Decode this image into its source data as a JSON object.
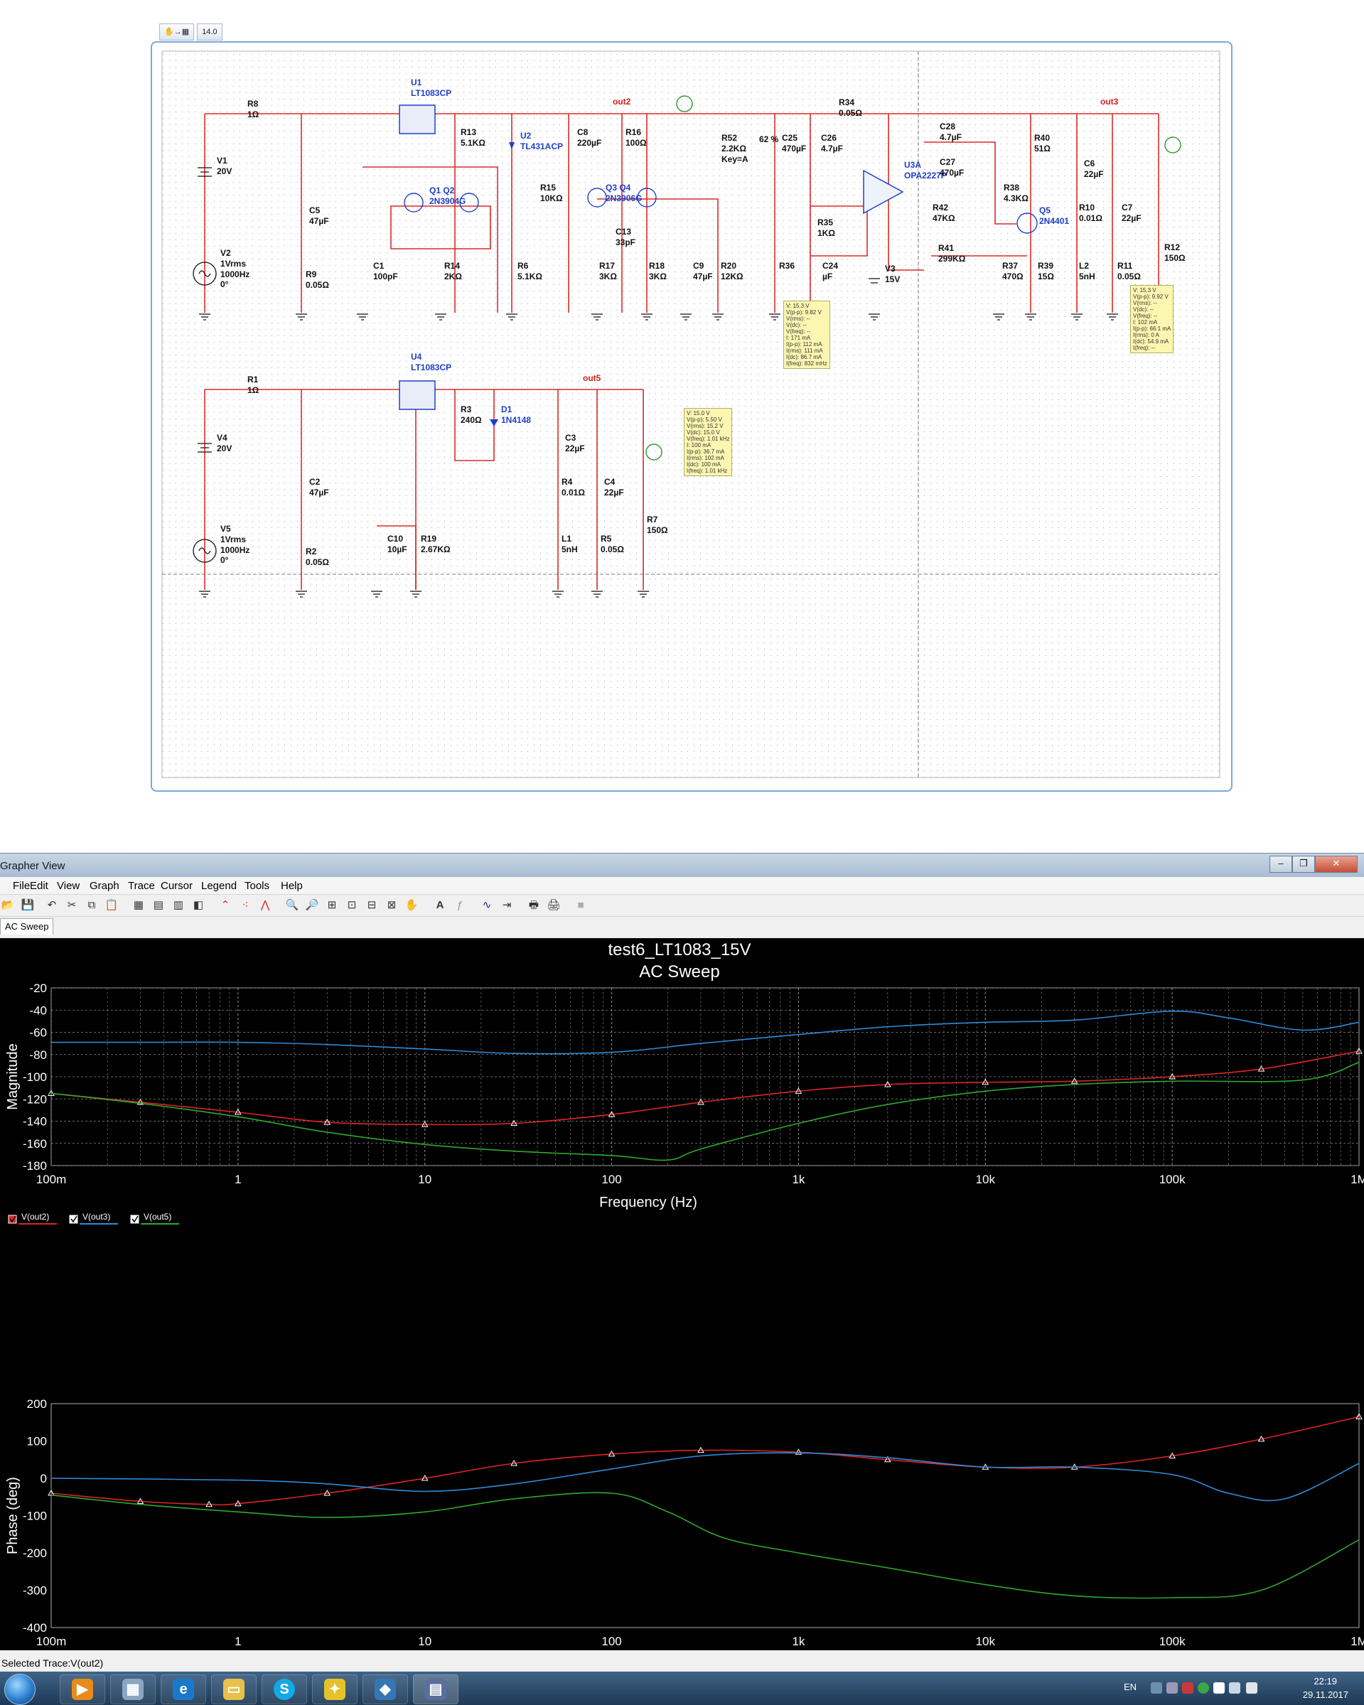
{
  "schematic": {
    "toolbar_value": "14.0",
    "components": [
      {
        "ref": "R8",
        "value": "1Ω"
      },
      {
        "ref": "U1",
        "value": "LT1083CP"
      },
      {
        "ref": "V1",
        "value": "20V"
      },
      {
        "ref": "V2",
        "value": "1Vrms",
        "extra": [
          "1000Hz",
          "0°"
        ]
      },
      {
        "ref": "C5",
        "value": "47µF"
      },
      {
        "ref": "R9",
        "value": "0.05Ω"
      },
      {
        "ref": "C1",
        "value": "100pF"
      },
      {
        "ref": "R13",
        "value": "5.1KΩ"
      },
      {
        "ref": "Q1 Q2",
        "value": "2N3904G"
      },
      {
        "ref": "R14",
        "value": "2KΩ"
      },
      {
        "ref": "U2",
        "value": "TL431ACP"
      },
      {
        "ref": "R6",
        "value": "5.1KΩ"
      },
      {
        "ref": "C8",
        "value": "220µF"
      },
      {
        "ref": "R15",
        "value": "10KΩ"
      },
      {
        "ref": "R16",
        "value": "100Ω"
      },
      {
        "ref": "Q3 Q4",
        "value": "2N3906G"
      },
      {
        "ref": "C13",
        "value": "33pF"
      },
      {
        "ref": "R17",
        "value": "3KΩ"
      },
      {
        "ref": "R18",
        "value": "3KΩ"
      },
      {
        "ref": "C9",
        "value": "47µF"
      },
      {
        "ref": "R20",
        "value": "12KΩ"
      },
      {
        "ref": "R52",
        "value": "2.2KΩ",
        "extra": [
          "Key=A"
        ]
      },
      {
        "ref": "C25",
        "value": "470µF"
      },
      {
        "ref": "C26",
        "value": "4.7µF"
      },
      {
        "ref": "R34",
        "value": "0.05Ω"
      },
      {
        "ref": "U3A",
        "value": "OPA2227P"
      },
      {
        "ref": "R35",
        "value": "1KΩ"
      },
      {
        "ref": "R36",
        "value": ""
      },
      {
        "ref": "C24",
        "value": "µF"
      },
      {
        "ref": "V3",
        "value": "15V"
      },
      {
        "ref": "C28",
        "value": "4.7µF"
      },
      {
        "ref": "C27",
        "value": "470µF"
      },
      {
        "ref": "R42",
        "value": "47KΩ"
      },
      {
        "ref": "R41",
        "value": "299KΩ"
      },
      {
        "ref": "R38",
        "value": "4.3KΩ"
      },
      {
        "ref": "R37",
        "value": "470Ω"
      },
      {
        "ref": "Q5",
        "value": "2N4401"
      },
      {
        "ref": "R39",
        "value": "15Ω"
      },
      {
        "ref": "R40",
        "value": "51Ω"
      },
      {
        "ref": "C6",
        "value": "22µF"
      },
      {
        "ref": "R10",
        "value": "0.01Ω"
      },
      {
        "ref": "L2",
        "value": "5nH"
      },
      {
        "ref": "C7",
        "value": "22µF"
      },
      {
        "ref": "R11",
        "value": "0.05Ω"
      },
      {
        "ref": "R12",
        "value": "150Ω"
      },
      {
        "ref": "R1",
        "value": "1Ω"
      },
      {
        "ref": "U4",
        "value": "LT1083CP"
      },
      {
        "ref": "V4",
        "value": "20V"
      },
      {
        "ref": "V5",
        "value": "1Vrms",
        "extra": [
          "1000Hz",
          "0°"
        ]
      },
      {
        "ref": "C2",
        "value": "47µF"
      },
      {
        "ref": "R2",
        "value": "0.05Ω"
      },
      {
        "ref": "R3",
        "value": "240Ω"
      },
      {
        "ref": "D1",
        "value": "1N4148"
      },
      {
        "ref": "C10",
        "value": "10µF"
      },
      {
        "ref": "R19",
        "value": "2.67KΩ"
      },
      {
        "ref": "C3",
        "value": "22µF"
      },
      {
        "ref": "R4",
        "value": "0.01Ω"
      },
      {
        "ref": "L1",
        "value": "5nH"
      },
      {
        "ref": "C4",
        "value": "22µF"
      },
      {
        "ref": "R5",
        "value": "0.05Ω"
      },
      {
        "ref": "R7",
        "value": "150Ω"
      }
    ],
    "nets": {
      "out2": "out2",
      "out3": "out3",
      "out5": "out5"
    },
    "pot_percent": "62 %",
    "probe_tooltips": [
      "V: 15.3 V\nV(p-p): 9.82 V\nV(rms): --\nV(dc): --\nV(freq): --\nI: 171 mA\nI(p-p): 112 mA\nI(rms): 111 mA\nI(dc): 86.7 mA\nI(freq): 832 mHz",
      "V: 15.3 V\nV(p-p): 9.92 V\nV(rms): --\nV(dc): --\nV(freq): --\nI: 102 mA\nI(p-p): 66.1 mA\nI(rms): 0 A\nI(dc): 54.9 mA\nI(freq): --",
      "V: 15.0 V\nV(p-p): 5.50 V\nV(rms): 15.2 V\nV(dc): 15.0 V\nV(freq): 1.01 kHz\nI: 100 mA\nI(p-p): 36.7 mA\nI(rms): 102 mA\nI(dc): 100 mA\nI(freq): 1.01 kHz"
    ]
  },
  "grapher": {
    "window_title": "Grapher View",
    "menu": [
      "File",
      "Edit",
      "View",
      "Graph",
      "Trace",
      "Cursor",
      "Legend",
      "Tools",
      "Help"
    ],
    "tab_label": "AC Sweep",
    "status_text": "Selected Trace:V(out2)",
    "colors": {
      "out2": "#e02424",
      "out3": "#2e8ad8",
      "out5": "#2ea82e",
      "grid": "#8a8a8a",
      "axis_text": "#ffffff"
    },
    "chart_data": [
      {
        "type": "line",
        "title": "test6_LT1083_15V",
        "subtitle": "AC Sweep",
        "xlabel": "Frequency (Hz)",
        "ylabel": "Magnitude",
        "xscale": "log",
        "xlim": [
          0.1,
          1000000
        ],
        "ylim": [
          -180,
          -20
        ],
        "xticks": [
          {
            "v": 0.1,
            "label": "100m"
          },
          {
            "v": 1,
            "label": "1"
          },
          {
            "v": 10,
            "label": "10"
          },
          {
            "v": 100,
            "label": "100"
          },
          {
            "v": 1000,
            "label": "1k"
          },
          {
            "v": 10000,
            "label": "10k"
          },
          {
            "v": 100000,
            "label": "100k"
          },
          {
            "v": 1000000,
            "label": "1M"
          }
        ],
        "yticks": [
          -20,
          -40,
          -60,
          -80,
          -100,
          -120,
          -140,
          -160,
          -180
        ],
        "grid": true,
        "legend": "bottom-left",
        "series": [
          {
            "name": "V(out2)",
            "color": "#e02424",
            "markers": true,
            "x": [
              0.1,
              0.3,
              1,
              3,
              10,
              30,
              100,
              300,
              1000,
              3000,
              10000,
              30000,
              100000,
              300000,
              1000000
            ],
            "y": [
              -115,
              -123,
              -132,
              -141,
              -143,
              -142,
              -134,
              -123,
              -113,
              -107,
              -105,
              -104,
              -100,
              -93,
              -77
            ]
          },
          {
            "name": "V(out3)",
            "color": "#2e8ad8",
            "markers": false,
            "x": [
              0.1,
              0.3,
              1,
              3,
              10,
              30,
              100,
              300,
              1000,
              3000,
              10000,
              30000,
              100000,
              200000,
              500000,
              1000000
            ],
            "y": [
              -69,
              -69,
              -69,
              -71,
              -75,
              -79,
              -78,
              -70,
              -62,
              -55,
              -51,
              -49,
              -41,
              -47,
              -58,
              -51
            ]
          },
          {
            "name": "V(out5)",
            "color": "#2ea82e",
            "markers": false,
            "x": [
              0.1,
              0.3,
              1,
              3,
              10,
              30,
              100,
              200,
              300,
              1000,
              3000,
              10000,
              30000,
              100000,
              500000,
              1000000
            ],
            "y": [
              -115,
              -124,
              -136,
              -150,
              -161,
              -167,
              -171,
              -175,
              -165,
              -142,
              -125,
              -113,
              -107,
              -104,
              -103,
              -87
            ]
          }
        ]
      },
      {
        "type": "line",
        "title": "",
        "xlabel": "Frequency (Hz)",
        "ylabel": "Phase (deg)",
        "xscale": "log",
        "xlim": [
          0.1,
          1000000
        ],
        "ylim": [
          -400,
          200
        ],
        "xticks": [
          {
            "v": 0.1,
            "label": "100m"
          },
          {
            "v": 1,
            "label": "1"
          },
          {
            "v": 10,
            "label": "10"
          },
          {
            "v": 100,
            "label": "100"
          },
          {
            "v": 1000,
            "label": "1k"
          },
          {
            "v": 10000,
            "label": "10k"
          },
          {
            "v": 100000,
            "label": "100k"
          },
          {
            "v": 1000000,
            "label": "1M"
          }
        ],
        "yticks": [
          200,
          100,
          0,
          -100,
          -200,
          -300,
          -400
        ],
        "grid": false,
        "legend": "bottom-left",
        "series": [
          {
            "name": "V(out2)",
            "color": "#e02424",
            "markers": true,
            "x": [
              0.1,
              0.3,
              0.7,
              1,
              3,
              10,
              30,
              100,
              300,
              1000,
              3000,
              10000,
              30000,
              100000,
              300000,
              1000000
            ],
            "y": [
              -40,
              -62,
              -70,
              -68,
              -40,
              0,
              40,
              65,
              75,
              70,
              50,
              30,
              30,
              60,
              105,
              165
            ]
          },
          {
            "name": "V(out3)",
            "color": "#2e8ad8",
            "markers": false,
            "x": [
              0.1,
              1,
              3,
              10,
              30,
              100,
              300,
              1000,
              3000,
              10000,
              30000,
              100000,
              200000,
              400000,
              1000000
            ],
            "y": [
              0,
              -5,
              -15,
              -35,
              -15,
              25,
              60,
              68,
              55,
              30,
              30,
              10,
              -40,
              -55,
              40
            ]
          },
          {
            "name": "V(out5)",
            "color": "#2ea82e",
            "markers": false,
            "x": [
              0.1,
              0.3,
              1,
              3,
              10,
              30,
              100,
              200,
              400,
              1000,
              3000,
              10000,
              30000,
              100000,
              300000,
              1000000
            ],
            "y": [
              -45,
              -70,
              -90,
              -105,
              -90,
              -55,
              -40,
              -90,
              -160,
              -200,
              -240,
              -285,
              -315,
              -320,
              -300,
              -165
            ]
          }
        ]
      }
    ]
  },
  "taskbar": {
    "lang": "EN",
    "time": "22:19",
    "date": "29.11.2017",
    "apps": [
      "media-player-icon",
      "calculator-icon",
      "internet-explorer-icon",
      "folder-icon",
      "skype-icon",
      "app-yellow-icon",
      "app-blue-icon",
      "multisim-icon"
    ]
  }
}
